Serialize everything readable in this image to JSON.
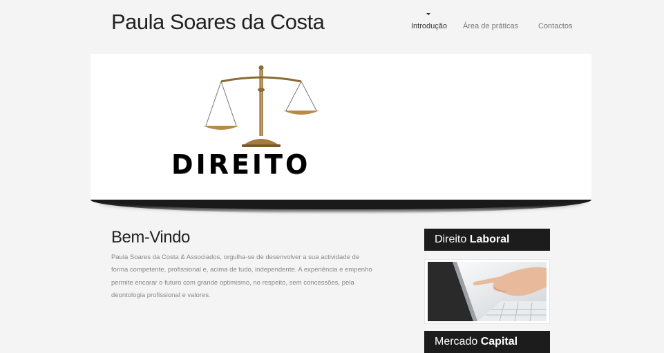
{
  "header": {
    "site_title": "Paula Soares da Costa"
  },
  "nav": {
    "items": [
      {
        "label": "Introdução",
        "active": true
      },
      {
        "label": "Área de práticas",
        "active": false
      },
      {
        "label": "Contactos",
        "active": false
      }
    ]
  },
  "banner": {
    "logo_text": "DIREITO"
  },
  "welcome": {
    "heading": "Bem-Vindo",
    "body": "Paula Soares da Costa & Associados, orgulha-se de desenvolver a sua actividade de forma competente, profissional e, acima de tudo, independente. A experiência e empenho permite encarar o futuro com grande optimismo, no respeito, sem concessões, pela deontologia profissional e valores."
  },
  "sidebar": {
    "boxes": [
      {
        "normal": "Direito ",
        "bold": "Laboral"
      },
      {
        "normal": "Mercado ",
        "bold": "Capital"
      }
    ]
  }
}
